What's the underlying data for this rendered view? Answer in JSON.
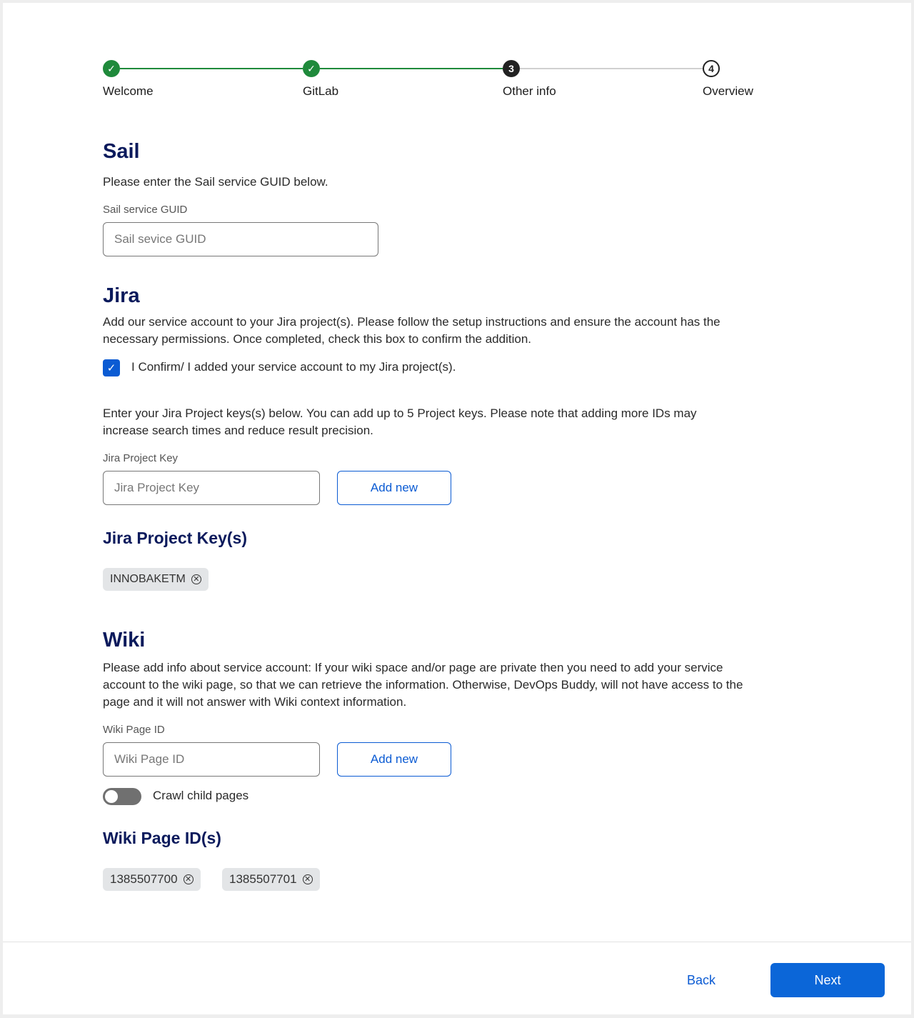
{
  "stepper": {
    "steps": [
      {
        "label": "Welcome",
        "state": "done",
        "marker": "✓"
      },
      {
        "label": "GitLab",
        "state": "done",
        "marker": "✓"
      },
      {
        "label": "Other info",
        "state": "current",
        "marker": "3"
      },
      {
        "label": "Overview",
        "state": "upcoming",
        "marker": "4"
      }
    ],
    "colors": {
      "done": "#1f8a3b",
      "current": "#222222",
      "line_done": "#1f8a3b",
      "line_pending": "#d0d0d0"
    }
  },
  "sail": {
    "title": "Sail",
    "description": "Please enter the Sail service GUID below.",
    "field_label": "Sail service GUID",
    "placeholder": "Sail sevice GUID"
  },
  "jira": {
    "title": "Jira",
    "description": "Add our service account to your Jira project(s). Please follow the setup instructions and ensure the account has the necessary permissions. Once completed, check this box to confirm the addition.",
    "confirm_checked": true,
    "confirm_label": "I Confirm/ I added your service account to my Jira project(s).",
    "keys_description": "Enter your Jira Project keys(s) below. You can add up to 5 Project keys. Please note that adding more IDs may increase search times and reduce result precision.",
    "field_label": "Jira Project Key",
    "placeholder": "Jira Project Key",
    "add_button": "Add new",
    "list_title": "Jira Project Key(s)",
    "keys": [
      "INNOBAKETM"
    ]
  },
  "wiki": {
    "title": "Wiki",
    "description": "Please add info about service account: If your wiki space and/or page are private then you need to add your service account to the wiki page, so that we can retrieve the information. Otherwise, DevOps Buddy, will not have access to the page and it will not answer with Wiki context information.",
    "field_label": "Wiki Page ID",
    "placeholder": "Wiki Page ID",
    "add_button": "Add new",
    "crawl_toggle_label": "Crawl child pages",
    "crawl_enabled": false,
    "list_title": "Wiki Page ID(s)",
    "ids": [
      "1385507700",
      "1385507701"
    ]
  },
  "footer": {
    "back_label": "Back",
    "next_label": "Next"
  },
  "colors": {
    "accent": "#0b5bd3",
    "heading": "#0b1a5c",
    "chip_bg": "#e3e5e7"
  },
  "icons": {
    "check": "check-icon",
    "remove": "close-circle-icon"
  }
}
